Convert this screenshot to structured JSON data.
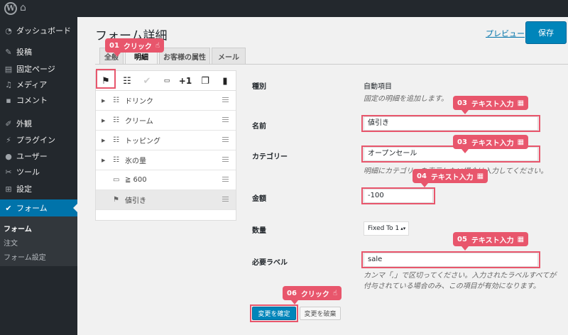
{
  "sidebar": {
    "items": [
      {
        "icon": "dashboard-icon",
        "glyph": "◔",
        "label": "ダッシュボード"
      },
      {
        "icon": "pin-icon",
        "glyph": "✎",
        "label": "投稿"
      },
      {
        "icon": "page-icon",
        "glyph": "▤",
        "label": "固定ページ"
      },
      {
        "icon": "media-icon",
        "glyph": "♫",
        "label": "メディア"
      },
      {
        "icon": "comment-icon",
        "glyph": "▪",
        "label": "コメント"
      },
      {
        "icon": "appearance-icon",
        "glyph": "✐",
        "label": "外観"
      },
      {
        "icon": "plugin-icon",
        "glyph": "⚡",
        "label": "プラグイン"
      },
      {
        "icon": "user-icon",
        "glyph": "●",
        "label": "ユーザー"
      },
      {
        "icon": "tool-icon",
        "glyph": "✂",
        "label": "ツール"
      },
      {
        "icon": "settings-icon",
        "glyph": "⊞",
        "label": "設定"
      },
      {
        "icon": "check-icon",
        "glyph": "✔",
        "label": "フォーム"
      }
    ],
    "submenu": [
      "フォーム",
      "注文",
      "フォーム設定"
    ]
  },
  "header": {
    "title": "フォーム詳細",
    "preview": "プレビュー",
    "save": "保存"
  },
  "tabs": [
    "全般",
    "明細",
    "お客様の属性",
    "メール"
  ],
  "panel": {
    "toolbar": [
      "flag-icon",
      "list-icon",
      "check-circle-icon",
      "counter-icon",
      "+1",
      "copy-icon",
      "trash-icon"
    ],
    "plus_one": "+1",
    "rows": [
      {
        "label": "ドリンク",
        "icon": "list-icon"
      },
      {
        "label": "クリーム",
        "icon": "list-icon"
      },
      {
        "label": "トッピング",
        "icon": "list-icon"
      },
      {
        "label": "氷の量",
        "icon": "list-icon"
      },
      {
        "label": "≧ 600",
        "icon": "counter-icon"
      },
      {
        "label": "値引き",
        "icon": "flag-icon"
      }
    ]
  },
  "form": {
    "type_label": "種別",
    "type_value": "自動項目",
    "type_desc": "固定の明細を追加します。",
    "name_label": "名前",
    "name_value": "値引き",
    "category_label": "カテゴリー",
    "category_value": "オープンセール",
    "category_desc": "明細にカテゴリーを表示したい場合は入力してください。",
    "amount_label": "金額",
    "amount_value": "-100",
    "qty_label": "数量",
    "qty_value": "Fixed To 1",
    "required_label": "必要ラベル",
    "required_value": "sale",
    "required_desc1": "カンマ「,」で区切ってください。入力されたラベルすべてが",
    "required_desc2": "付与されている場合のみ、この項目が有効になります。",
    "confirm": "変更を確定",
    "discard": "変更を破棄"
  },
  "callouts": {
    "c01_num": "01",
    "c01_text": "クリック",
    "c03a_num": "03",
    "c03a_text": "テキスト入力",
    "c03b_num": "03",
    "c03b_text": "テキスト入力",
    "c04_num": "04",
    "c04_text": "テキスト入力",
    "c05_num": "05",
    "c05_text": "テキスト入力",
    "c06_num": "06",
    "c06_text": "クリック"
  }
}
